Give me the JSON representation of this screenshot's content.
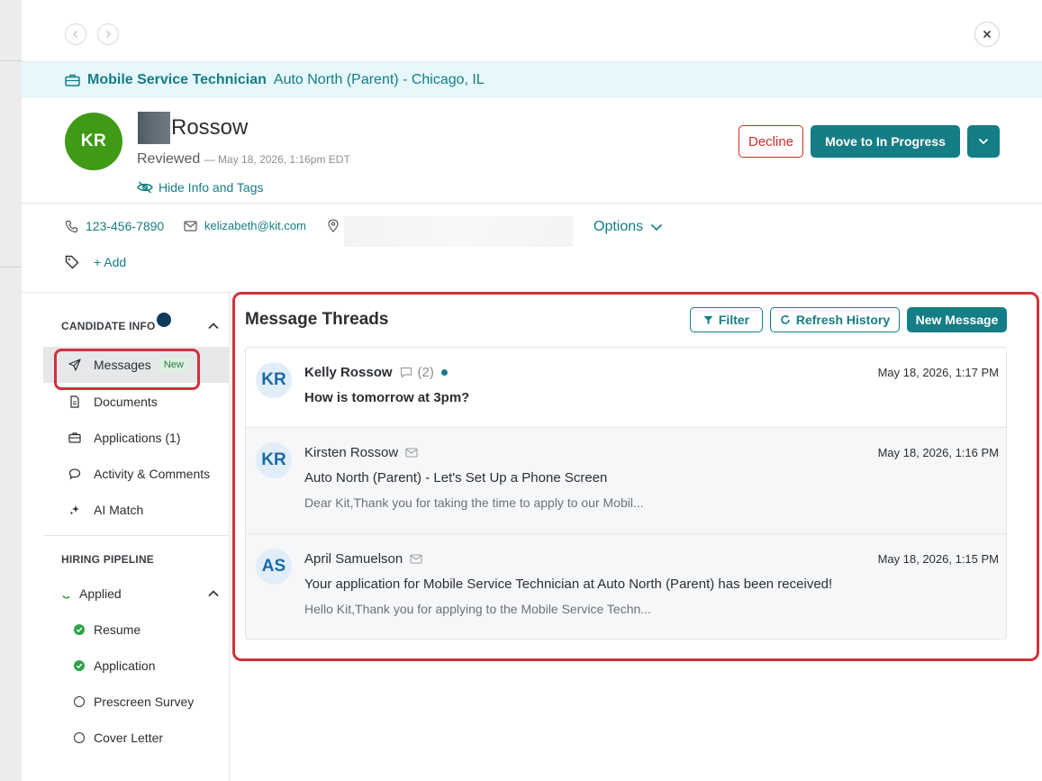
{
  "job": {
    "title": "Mobile Service Technician",
    "company_location": "Auto North (Parent) - Chicago, IL"
  },
  "candidate": {
    "initials": "KR",
    "name": "Rossow",
    "status": "Reviewed",
    "status_date": "— May 18, 2026, 1:16pm EDT",
    "hide_info_label": "Hide Info and Tags",
    "phone": "123-456-7890",
    "email": "kelizabeth@kit.com",
    "options_label": "Options",
    "add_tag_label": "+ Add"
  },
  "actions": {
    "decline": "Decline",
    "move": "Move to In Progress"
  },
  "sidebar": {
    "candidate_info_heading": "CANDIDATE INFO",
    "items": [
      {
        "label": "Messages",
        "badge": "New"
      },
      {
        "label": "Documents"
      },
      {
        "label": "Applications (1)"
      },
      {
        "label": "Activity & Comments"
      },
      {
        "label": "AI Match"
      }
    ],
    "hiring_pipeline_heading": "HIRING PIPELINE",
    "pipeline": [
      {
        "label": "Applied"
      },
      {
        "label": "Resume"
      },
      {
        "label": "Application"
      },
      {
        "label": "Prescreen Survey"
      },
      {
        "label": "Cover Letter"
      }
    ]
  },
  "main": {
    "title": "Message Threads",
    "filter_label": "Filter",
    "refresh_label": "Refresh History",
    "new_message_label": "New Message",
    "threads": [
      {
        "initials": "KR",
        "name": "Kelly Rossow",
        "count": "(2)",
        "time": "May 18, 2026, 1:17 PM",
        "subject": "How is tomorrow at 3pm?",
        "preview": ""
      },
      {
        "initials": "KR",
        "name": "Kirsten Rossow",
        "time": "May 18, 2026, 1:16 PM",
        "subject": "Auto North (Parent) - Let's Set Up a Phone Screen",
        "preview": "Dear Kit,Thank you for taking the time to apply to our Mobil..."
      },
      {
        "initials": "AS",
        "name": "April Samuelson",
        "time": "May 18, 2026, 1:15 PM",
        "subject": "Your application for Mobile Service Technician at Auto North (Parent) has been received!",
        "preview": "Hello Kit,Thank you for applying to the Mobile Service Techn..."
      }
    ]
  },
  "colors": {
    "brand": "#157d86",
    "avatar_green": "#3f9b16",
    "decline_red": "#c9302c",
    "highlight_red": "#d0323a",
    "banner_bg": "#e6f8fb"
  }
}
